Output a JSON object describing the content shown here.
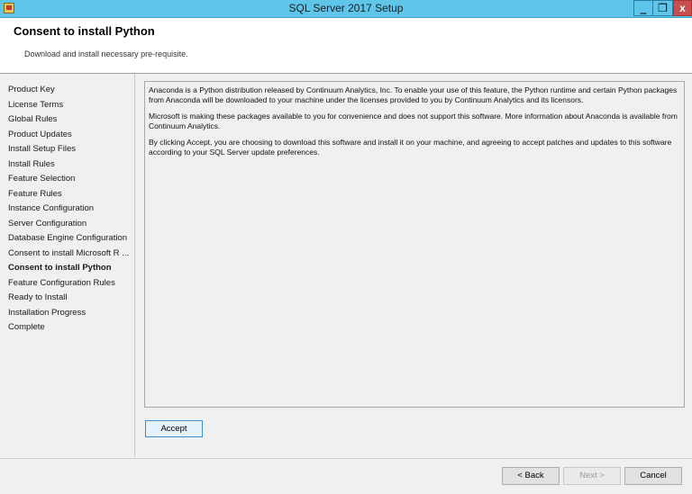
{
  "window": {
    "title": "SQL Server 2017 Setup",
    "minimize_glyph": "‗",
    "maximize_glyph": "❐",
    "close_glyph": "x"
  },
  "header": {
    "title": "Consent to install Python",
    "subtitle": "Download and install necessary pre-requisite."
  },
  "sidebar": {
    "items": [
      {
        "label": "Product Key"
      },
      {
        "label": "License Terms"
      },
      {
        "label": "Global Rules"
      },
      {
        "label": "Product Updates"
      },
      {
        "label": "Install Setup Files"
      },
      {
        "label": "Install Rules"
      },
      {
        "label": "Feature Selection"
      },
      {
        "label": "Feature Rules"
      },
      {
        "label": "Instance Configuration"
      },
      {
        "label": "Server Configuration"
      },
      {
        "label": "Database Engine Configuration"
      },
      {
        "label": "Consent to install Microsoft R ..."
      },
      {
        "label": "Consent to install Python",
        "active": true
      },
      {
        "label": "Feature Configuration Rules"
      },
      {
        "label": "Ready to Install"
      },
      {
        "label": "Installation Progress"
      },
      {
        "label": "Complete"
      }
    ]
  },
  "content": {
    "paragraphs": [
      "Anaconda is a Python distribution released by Continuum Analytics, Inc. To enable your use of this feature, the Python runtime and certain Python packages from Anaconda will be downloaded to your machine under the licenses provided to you by Continuum Analytics and its licensors.",
      "Microsoft is making these packages available to you for convenience and does not support this software. More information about Anaconda is available from Continuum Analytics.",
      "By clicking Accept, you are choosing to download this software and install it on your machine, and agreeing to accept patches and updates to this software according to your SQL Server update preferences."
    ]
  },
  "buttons": {
    "accept": "Accept",
    "back": "< Back",
    "next": "Next >",
    "cancel": "Cancel"
  }
}
